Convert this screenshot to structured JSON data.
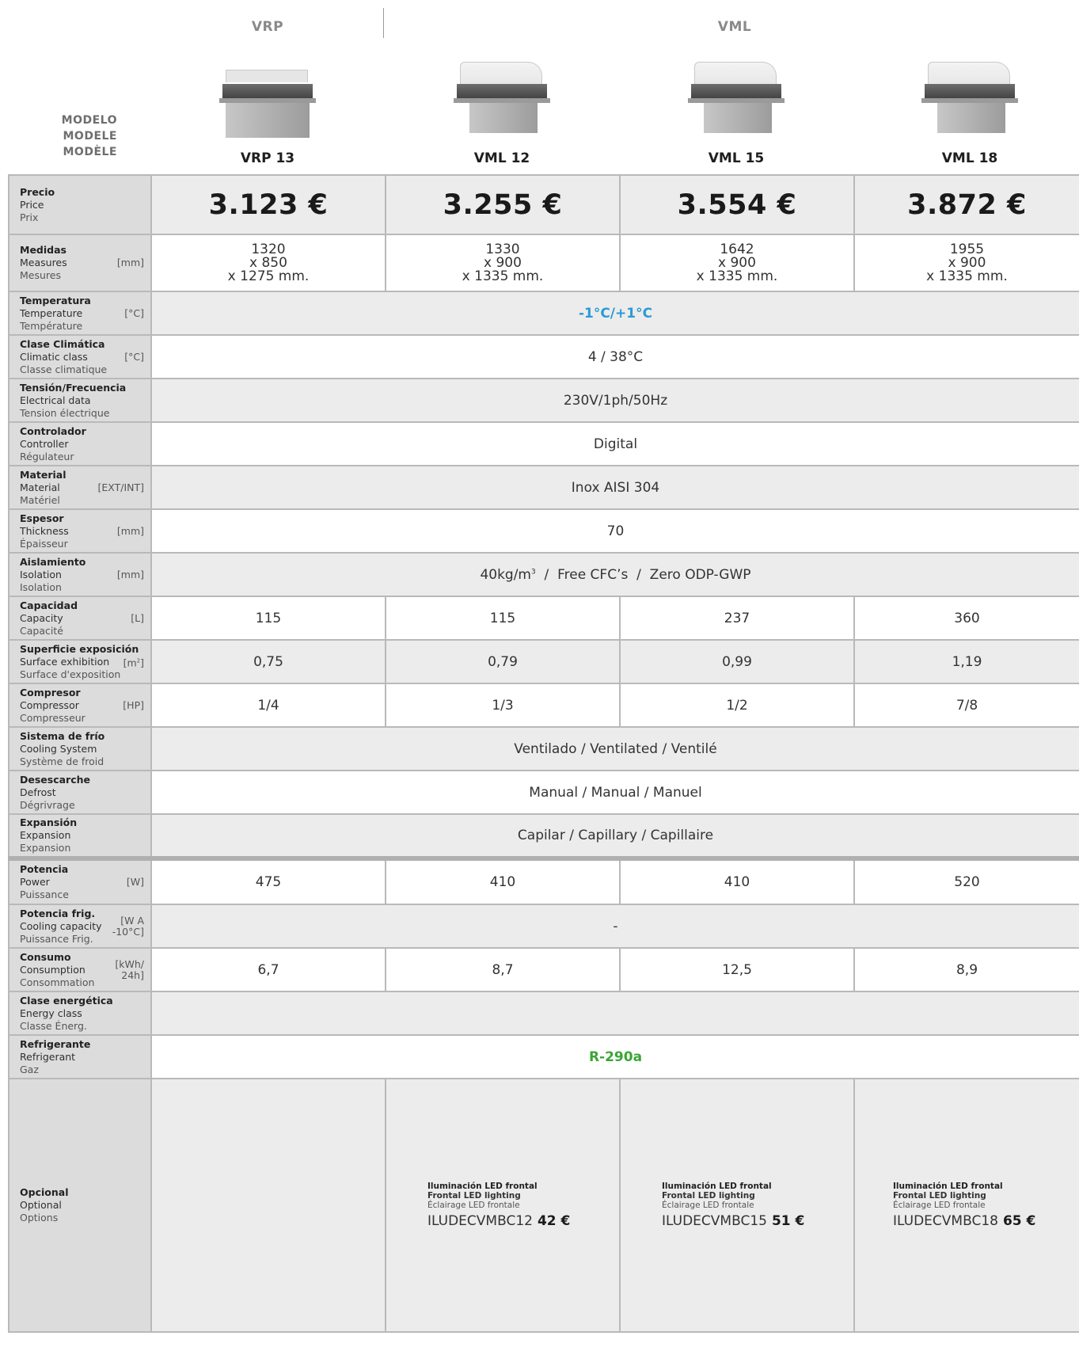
{
  "families": [
    "VRP",
    "VML"
  ],
  "modelo_labels": [
    "MODELO",
    "MODELE",
    "MODÈLE"
  ],
  "models": [
    "VRP 13",
    "VML 12",
    "VML 15",
    "VML 18"
  ],
  "rows": {
    "precio": {
      "l1": "Precio",
      "l2": "Price",
      "l3": "Prix",
      "values": [
        "3.123 €",
        "3.255 €",
        "3.554 €",
        "3.872 €"
      ]
    },
    "medidas": {
      "l1": "Medidas",
      "l2": "Measures",
      "l3": "Mesures",
      "unit": "[mm]",
      "values": [
        [
          "1320",
          "x 850",
          "x 1275 mm."
        ],
        [
          "1330",
          "x 900",
          "x 1335 mm."
        ],
        [
          "1642",
          "x 900",
          "x 1335 mm."
        ],
        [
          "1955",
          "x 900",
          "x 1335 mm."
        ]
      ]
    },
    "temperatura": {
      "l1": "Temperatura",
      "l2": "Temperature",
      "l3": "Température",
      "unit": "[°C]",
      "value": "-1°C/+1°C"
    },
    "clase_climatica": {
      "l1": "Clase Climática",
      "l2": "Climatic class",
      "l3": "Classe climatique",
      "unit": "[°C]",
      "value": "4 / 38°C"
    },
    "tension": {
      "l1": "Tensión/Frecuencia",
      "l2": "Electrical data",
      "l3": "Tension électrique",
      "value": "230V/1ph/50Hz"
    },
    "controlador": {
      "l1": "Controlador",
      "l2": "Controller",
      "l3": "Régulateur",
      "value": "Digital"
    },
    "material": {
      "l1": "Material",
      "l2": "Material",
      "l3": "Matériel",
      "unit": "[EXT/INT]",
      "value": "Inox AISI 304"
    },
    "espesor": {
      "l1": "Espesor",
      "l2": "Thickness",
      "l3": "Épaisseur",
      "unit": "[mm]",
      "value": "70"
    },
    "aislamiento": {
      "l1": "Aislamiento",
      "l2": "Isolation",
      "l3": "Isolation",
      "unit": "[mm]",
      "value_a": "40kg/m",
      "value_sup": "3",
      "value_b": "  /  Free CFC’s  /  Zero ODP-GWP"
    },
    "capacidad": {
      "l1": "Capacidad",
      "l2": "Capacity",
      "l3": "Capacité",
      "unit": "[L]",
      "values": [
        "115",
        "115",
        "237",
        "360"
      ]
    },
    "superficie": {
      "l1": "Superficie exposición",
      "l2": "Surface exhibition",
      "l3": "Surface d'exposition",
      "unit_a": "[m",
      "unit_sup": "2",
      "unit_b": "]",
      "values": [
        "0,75",
        "0,79",
        "0,99",
        "1,19"
      ]
    },
    "compresor": {
      "l1": "Compresor",
      "l2": "Compressor",
      "l3": "Compresseur",
      "unit": "[HP]",
      "values": [
        "1/4",
        "1/3",
        "1/2",
        "7/8"
      ]
    },
    "sistema": {
      "l1": "Sistema de frío",
      "l2": "Cooling System",
      "l3": "Système de froid",
      "value": "Ventilado / Ventilated / Ventilé"
    },
    "desescarche": {
      "l1": "Desescarche",
      "l2": "Defrost",
      "l3": "Dégrivrage",
      "value": "Manual / Manual / Manuel"
    },
    "expansion": {
      "l1": "Expansión",
      "l2": "Expansion",
      "l3": "Expansion",
      "value": "Capilar / Capillary / Capillaire"
    },
    "potencia": {
      "l1": "Potencia",
      "l2": "Power",
      "l3": "Puissance",
      "unit": "[W]",
      "values": [
        "475",
        "410",
        "410",
        "520"
      ]
    },
    "potencia_frig": {
      "l1": "Potencia frig.",
      "l2": "Cooling capacity",
      "l3": "Puissance Frig.",
      "unit_a": "[W A",
      "unit_b": "-10°C]",
      "value": "-"
    },
    "consumo": {
      "l1": "Consumo",
      "l2": "Consumption",
      "l3": "Consommation",
      "unit_a": "[kWh/",
      "unit_b": "24h]",
      "values": [
        "6,7",
        "8,7",
        "12,5",
        "8,9"
      ]
    },
    "clase_energetica": {
      "l1": "Clase energética",
      "l2": "Energy class",
      "l3": "Classe Énerg.",
      "value": ""
    },
    "refrigerante": {
      "l1": "Refrigerante",
      "l2": "Refrigerant",
      "l3": "Gaz",
      "value": "R-290a"
    },
    "opcional": {
      "l1": "Opcional",
      "l2": "Optional",
      "l3": "Options",
      "items": [
        null,
        {
          "t1": "Iluminación LED frontal",
          "t2": "Frontal LED lighting",
          "t3": "Éclairage LED frontale",
          "code": "ILUDECVMBC12",
          "price": "42 €"
        },
        {
          "t1": "Iluminación LED frontal",
          "t2": "Frontal LED lighting",
          "t3": "Éclairage LED frontale",
          "code": "ILUDECVMBC15",
          "price": "51 €"
        },
        {
          "t1": "Iluminación LED frontal",
          "t2": "Frontal LED lighting",
          "t3": "Éclairage LED frontale",
          "code": "ILUDECVMBC18",
          "price": "65 €"
        }
      ]
    }
  }
}
